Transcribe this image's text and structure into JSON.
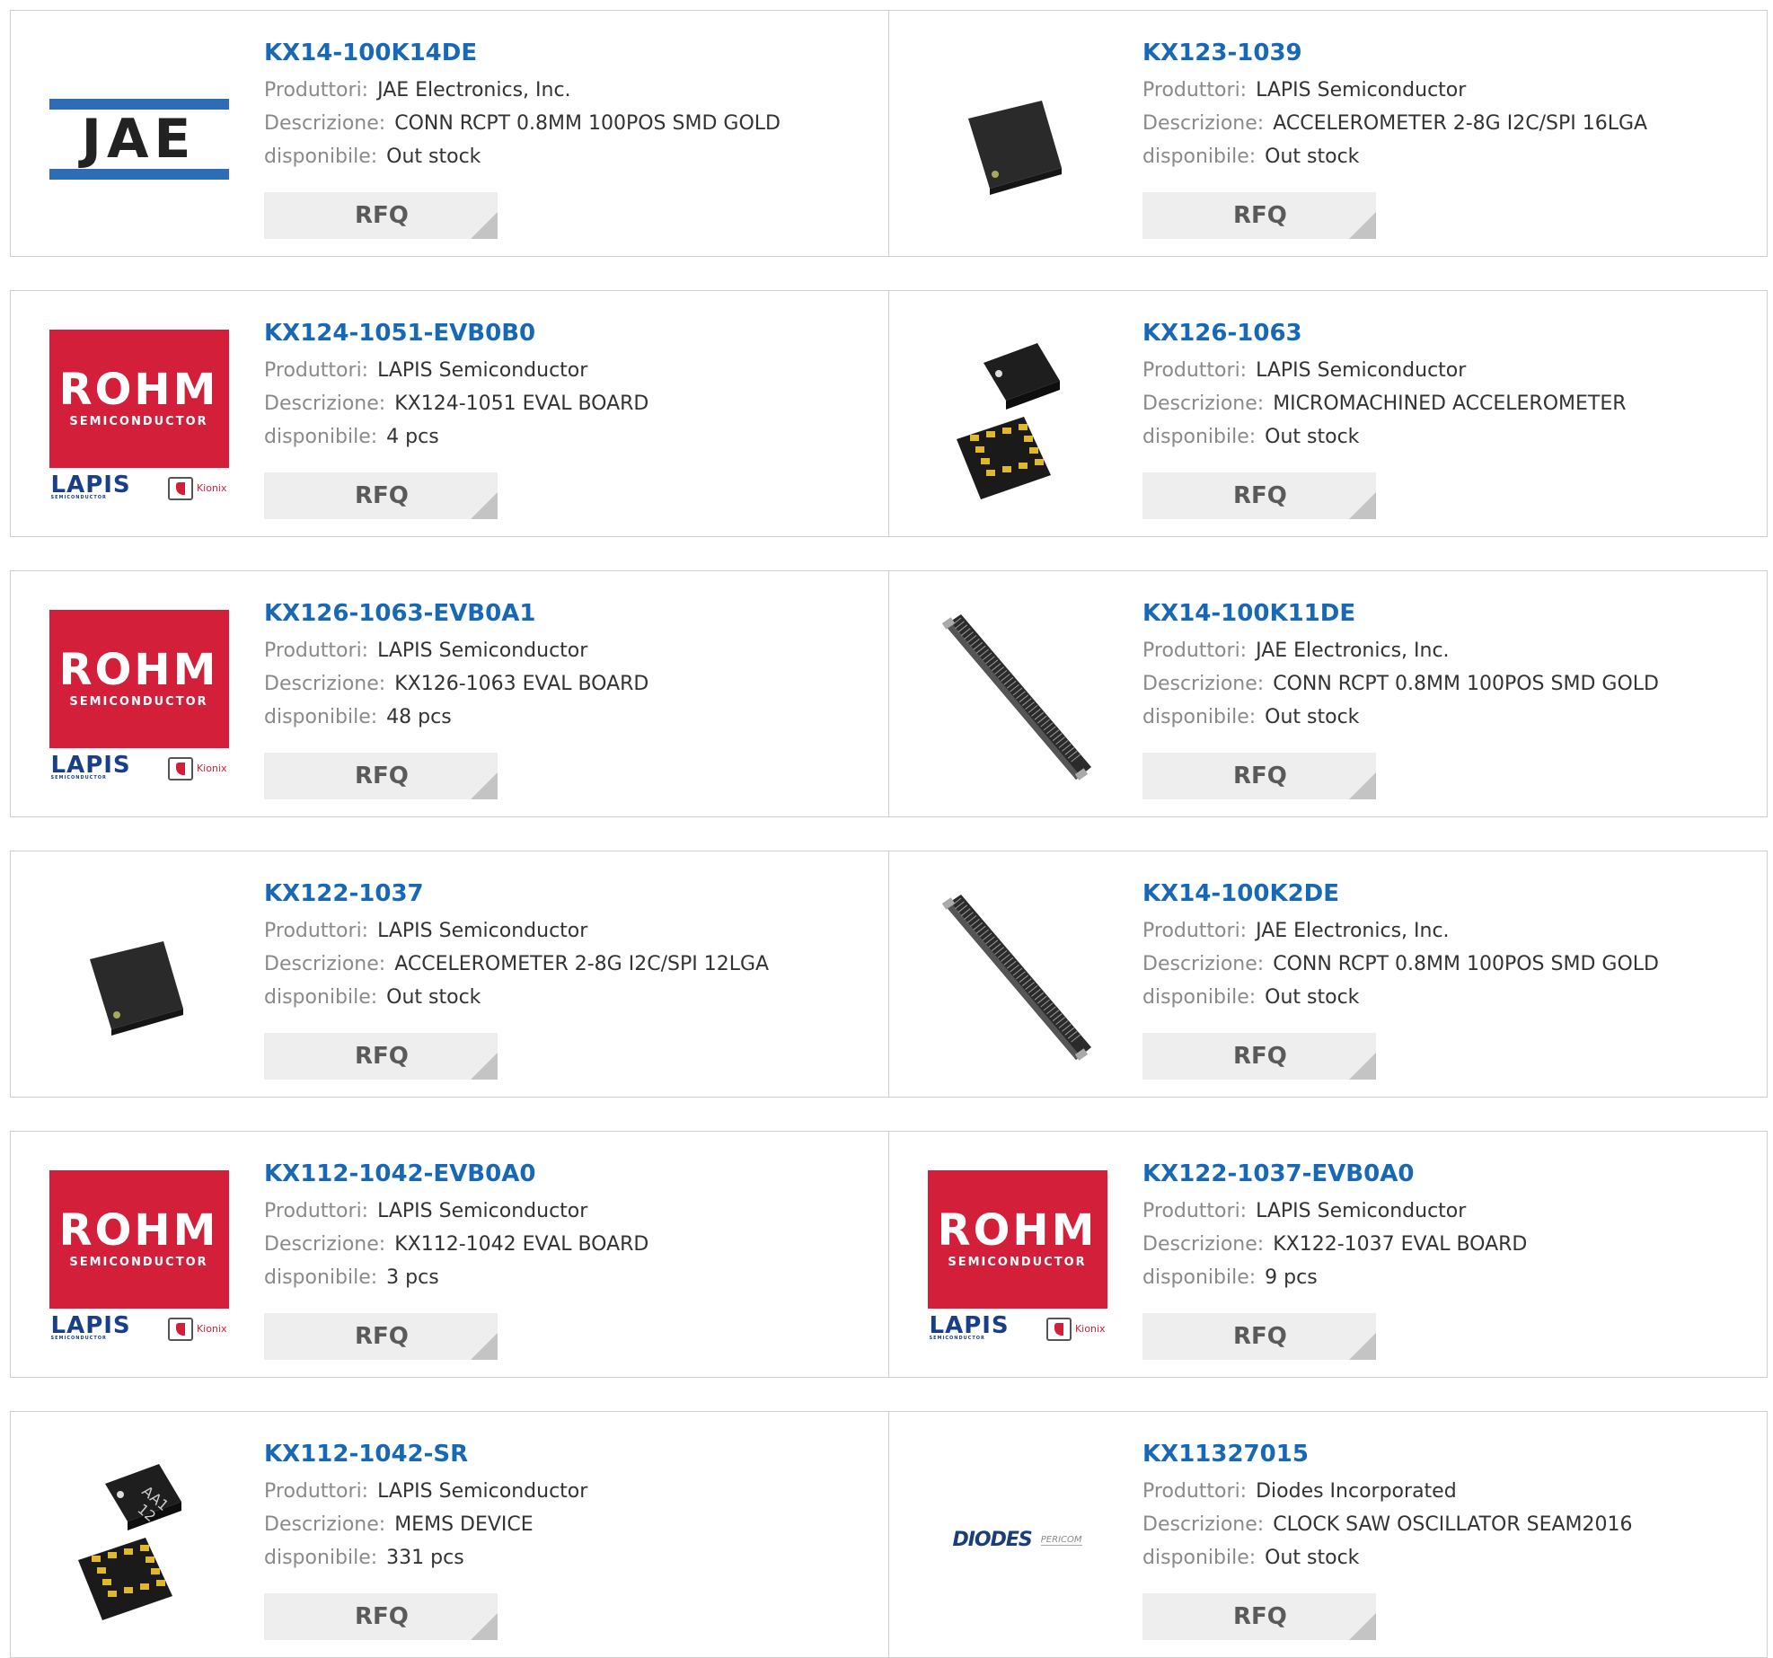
{
  "labels": {
    "manufacturer": "Produttori:",
    "description": "Descrizione:",
    "availability": "disponibile:",
    "rfq": "RFQ"
  },
  "products": [
    {
      "part": "KX14-100K14DE",
      "manufacturer": "JAE Electronics, Inc.",
      "description": "CONN RCPT 0.8MM 100POS SMD GOLD",
      "availability": "Out stock",
      "image": "jae-logo"
    },
    {
      "part": "KX123-1039",
      "manufacturer": "LAPIS Semiconductor",
      "description": "ACCELEROMETER 2-8G I2C/SPI 16LGA",
      "availability": "Out stock",
      "image": "chip-photo"
    },
    {
      "part": "KX124-1051-EVB0B0",
      "manufacturer": "LAPIS Semiconductor",
      "description": "KX124-1051 EVAL BOARD",
      "availability": "4 pcs",
      "image": "rohm-logo"
    },
    {
      "part": "KX126-1063",
      "manufacturer": "LAPIS Semiconductor",
      "description": "MICROMACHINED ACCELEROMETER",
      "availability": "Out stock",
      "image": "chip-pair-photo"
    },
    {
      "part": "KX126-1063-EVB0A1",
      "manufacturer": "LAPIS Semiconductor",
      "description": "KX126-1063 EVAL BOARD",
      "availability": "48 pcs",
      "image": "rohm-logo"
    },
    {
      "part": "KX14-100K11DE",
      "manufacturer": "JAE Electronics, Inc.",
      "description": "CONN RCPT 0.8MM 100POS SMD GOLD",
      "availability": "Out stock",
      "image": "connector-photo"
    },
    {
      "part": "KX122-1037",
      "manufacturer": "LAPIS Semiconductor",
      "description": "ACCELEROMETER 2-8G I2C/SPI 12LGA",
      "availability": "Out stock",
      "image": "chip-photo"
    },
    {
      "part": "KX14-100K2DE",
      "manufacturer": "JAE Electronics, Inc.",
      "description": "CONN RCPT 0.8MM 100POS SMD GOLD",
      "availability": "Out stock",
      "image": "connector-photo"
    },
    {
      "part": "KX112-1042-EVB0A0",
      "manufacturer": "LAPIS Semiconductor",
      "description": "KX112-1042 EVAL BOARD",
      "availability": "3 pcs",
      "image": "rohm-logo"
    },
    {
      "part": "KX122-1037-EVB0A0",
      "manufacturer": "LAPIS Semiconductor",
      "description": "KX122-1037 EVAL BOARD",
      "availability": "9 pcs",
      "image": "rohm-logo"
    },
    {
      "part": "KX112-1042-SR",
      "manufacturer": "LAPIS Semiconductor",
      "description": "MEMS DEVICE",
      "availability": "331 pcs",
      "image": "chip-pair-marked-photo"
    },
    {
      "part": "KX11327015",
      "manufacturer": "Diodes Incorporated",
      "description": "CLOCK SAW OSCILLATOR SEAM2016",
      "availability": "Out stock",
      "image": "diodes-logo"
    }
  ],
  "logo_text": {
    "rohm": "ROHM",
    "rohm_sub": "SEMICONDUCTOR",
    "lapis": "LAPIS",
    "lapis_sub": "SEMICONDUCTOR",
    "kionix": "Kionix",
    "jae": "JAE",
    "diodes": "DIODES",
    "pericom": "PERICOM"
  },
  "colors": {
    "link": "#1868b8",
    "rohm_red": "#d31f3a",
    "label_gray": "#8a8a8a",
    "button_bg": "#eeeeee"
  }
}
